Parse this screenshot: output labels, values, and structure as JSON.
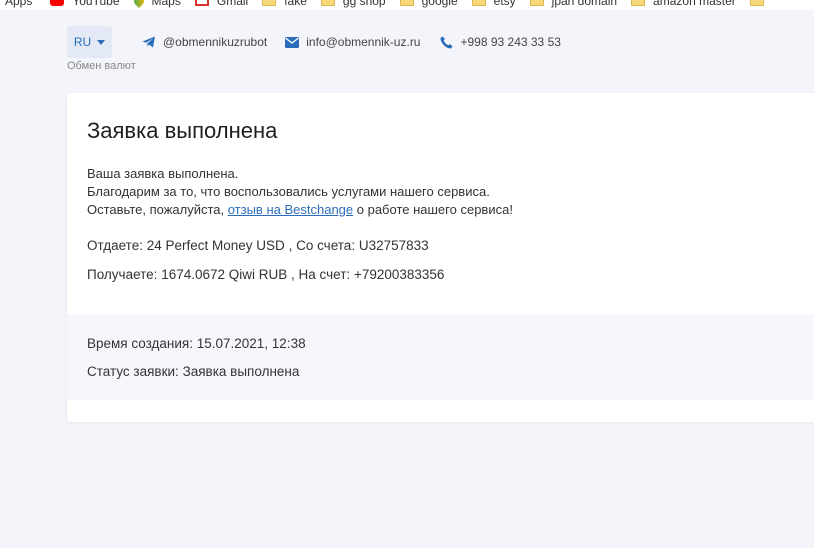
{
  "bookmarks": [
    {
      "label": "Apps",
      "icon": "apps-icon"
    },
    {
      "label": "YouTube",
      "icon": "youtube-icon"
    },
    {
      "label": "Maps",
      "icon": "maps-icon"
    },
    {
      "label": "Gmail",
      "icon": "gmail-icon"
    },
    {
      "label": "fake",
      "icon": "folder-icon"
    },
    {
      "label": "gg shop",
      "icon": "folder-icon"
    },
    {
      "label": "google",
      "icon": "folder-icon"
    },
    {
      "label": "etsy",
      "icon": "folder-icon"
    },
    {
      "label": "jpan domain",
      "icon": "folder-icon"
    },
    {
      "label": "amazon master",
      "icon": "folder-icon"
    }
  ],
  "header": {
    "lang": "RU",
    "telegram": "@obmennikuzrubot",
    "email": "info@obmennik-uz.ru",
    "phone": "+998 93 243 33 53",
    "site_name": "Обмен валют"
  },
  "order": {
    "title": "Заявка выполнена",
    "msg_line1": "Ваша заявка выполнена.",
    "msg_line2": "Благодарим за то, что воспользовались услугами нашего сервиса.",
    "msg_line3_before": "Оставьте, пожалуйста, ",
    "msg_link": "отзыв на Bestchange",
    "msg_line3_after": " о работе нашего сервиса!",
    "give_label": "Отдаете:",
    "give_value": "24 Perfect Money USD",
    "give_account_label": "Со счета:",
    "give_account": "U32757833",
    "get_label": "Получаете:",
    "get_value": "1674.0672 Qiwi RUB",
    "get_account_label": "На счет:",
    "get_account": "+79200383356",
    "created_label": "Время создания:",
    "created_value": "15.07.2021, 12:38",
    "status_label": "Статус заявки:",
    "status_value": "Заявка выполнена"
  },
  "colors": {
    "accent": "#2a6ebb",
    "background": "#f3f5fb",
    "card": "#ffffff",
    "meta_bg": "#f5f7fc"
  }
}
